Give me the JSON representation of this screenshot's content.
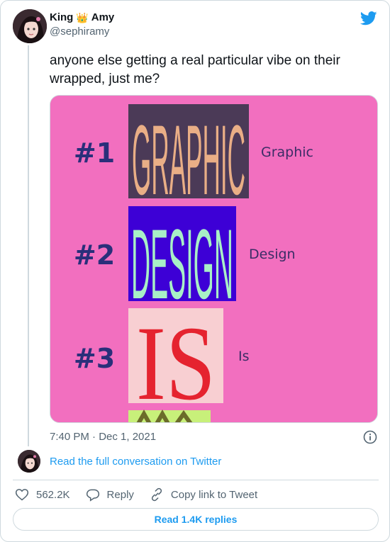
{
  "user": {
    "display_name_first": "King",
    "display_name_emoji": "👑",
    "display_name_last": "Amy",
    "handle": "@sephiramy"
  },
  "tweet": {
    "text": "anyone else getting a real particular vibe on their wrapped, just me?",
    "timestamp": "7:40 PM · Dec 1, 2021"
  },
  "media": {
    "background_color": "#f26fbf",
    "rows": [
      {
        "rank": "#1",
        "word": "GRAPHIC",
        "label": "Graphic",
        "box_color": "#4b3a57",
        "text_color": "#e9ae86"
      },
      {
        "rank": "#2",
        "word": "DESIGN",
        "label": "Design",
        "box_color": "#3d00d6",
        "text_color": "#a8f0c6"
      },
      {
        "rank": "#3",
        "word": "IS",
        "label": "Is",
        "box_color": "#f8cfd2",
        "text_color": "#e5232f"
      }
    ]
  },
  "footer": {
    "read_conversation": "Read the full conversation on Twitter",
    "like_count": "562.2K",
    "reply_label": "Reply",
    "copy_link_label": "Copy link to Tweet",
    "read_replies": "Read 1.4K replies"
  },
  "colors": {
    "link_blue": "#1d9bf0",
    "secondary_text": "#536471",
    "border": "#cfd9de"
  },
  "icons": [
    "twitter-bird-icon",
    "info-icon",
    "heart-icon",
    "reply-bubble-icon",
    "link-icon"
  ]
}
